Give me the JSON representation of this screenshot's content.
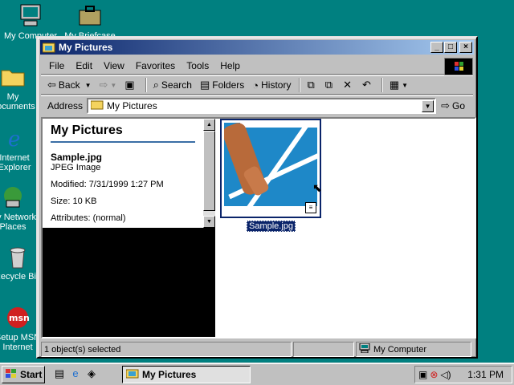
{
  "desktop": {
    "icons": [
      {
        "label": "My Computer",
        "icon": "computer-icon"
      },
      {
        "label": "My Briefcase",
        "icon": "briefcase-icon"
      },
      {
        "label": "My Documents",
        "icon": "folder-icon"
      },
      {
        "label": "Internet Explorer",
        "icon": "ie-icon"
      },
      {
        "label": "My Network Places",
        "icon": "network-icon"
      },
      {
        "label": "Recycle Bin",
        "icon": "recycle-icon"
      },
      {
        "label": "Setup MSN Internet",
        "icon": "msn-icon"
      }
    ]
  },
  "window": {
    "title": "My Pictures",
    "menu": [
      "File",
      "Edit",
      "View",
      "Favorites",
      "Tools",
      "Help"
    ],
    "toolbar": {
      "back": "Back",
      "search": "Search",
      "folders": "Folders",
      "history": "History"
    },
    "address": {
      "label": "Address",
      "value": "My Pictures",
      "go": "Go"
    },
    "info": {
      "heading": "My Pictures",
      "filename": "Sample.jpg",
      "filetype": "JPEG Image",
      "modified": "Modified: 7/31/1999 1:27 PM",
      "size": "Size: 10 KB",
      "attributes": "Attributes: (normal)"
    },
    "file": {
      "name": "Sample.jpg"
    },
    "status": {
      "selected": "1 object(s) selected",
      "location": "My Computer"
    }
  },
  "taskbar": {
    "start": "Start",
    "task": "My Pictures",
    "time": "1:31 PM"
  }
}
